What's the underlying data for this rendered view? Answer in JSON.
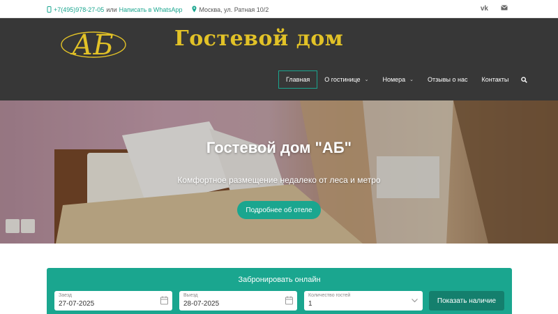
{
  "topbar": {
    "phone": "+7(495)978-27-05",
    "or_text": "или",
    "whatsapp_link": "Написать в WhatsApp",
    "address": "Москва, ул. Ратная 10/2",
    "social_vk": "vk",
    "icons": [
      "phone-icon",
      "map-pin-icon",
      "vk-icon",
      "mail-icon"
    ]
  },
  "header": {
    "logo_text": "АБ",
    "brand": "Гостевой дом",
    "nav": [
      {
        "label": "Главная",
        "active": true
      },
      {
        "label": "О гостинице",
        "dropdown": true
      },
      {
        "label": "Номера",
        "dropdown": true
      },
      {
        "label": "Отзывы о нас"
      },
      {
        "label": "Контакты"
      }
    ]
  },
  "hero": {
    "title": "Гостевой дом \"АБ\"",
    "subtitle": "Комфортное размещение недалеко от леса и метро",
    "button": "Подробнее об отеле"
  },
  "booking": {
    "title": "Забронировать онлайн",
    "checkin_label": "Заезд",
    "checkin_value": "27-07-2025",
    "checkout_label": "Выезд",
    "checkout_value": "28-07-2025",
    "guests_label": "Количество гостей",
    "guests_value": "1",
    "submit": "Показать наличие"
  },
  "colors": {
    "accent": "#1aa68f",
    "header_bg": "#373737",
    "brand_gold": "#e2c227"
  }
}
